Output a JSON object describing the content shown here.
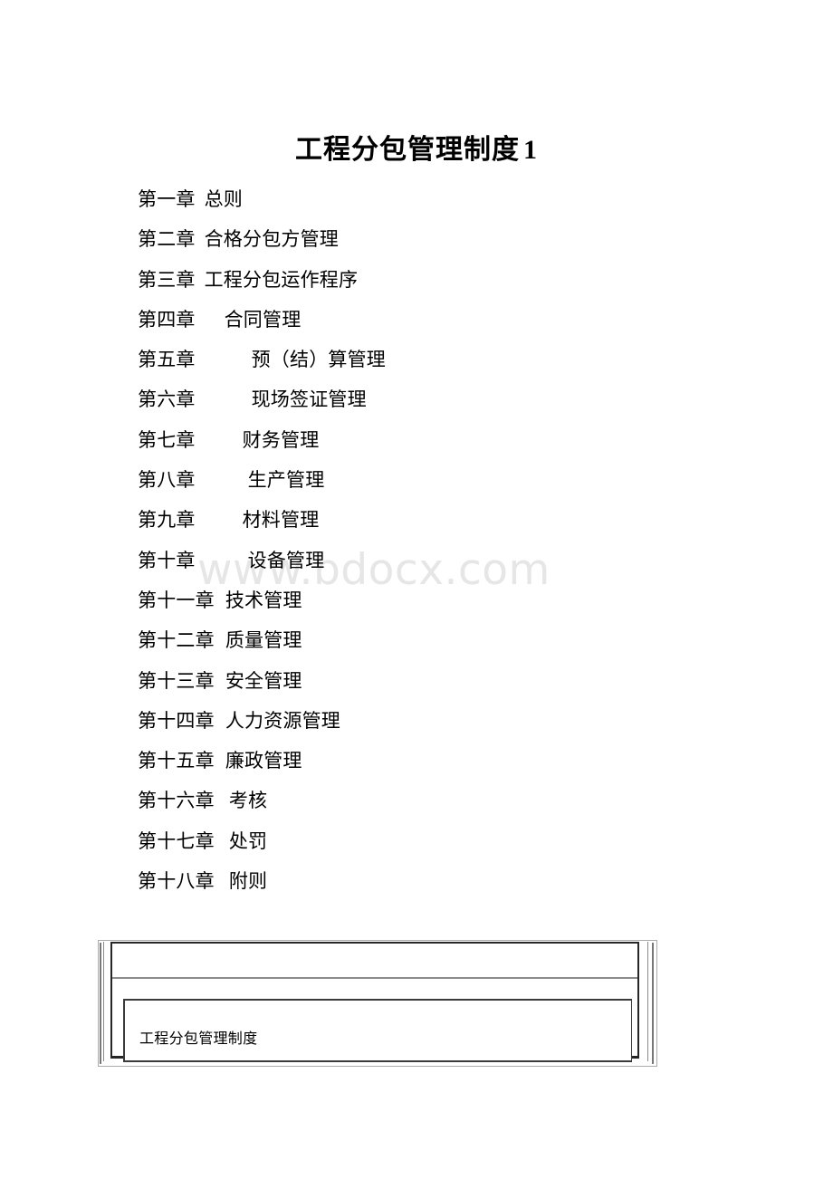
{
  "document": {
    "title_main": "工程分包管理制度",
    "title_suffix": "1"
  },
  "watermark": {
    "text": "www.bdocx.com",
    "color": "#e6e6e6"
  },
  "toc": {
    "entries": [
      {
        "chapter": "第一章",
        "title": "总则",
        "indent": 0,
        "gap": 10
      },
      {
        "chapter": "第二章",
        "title": "合格分包方管理",
        "indent": 0,
        "gap": 10
      },
      {
        "chapter": "第三章",
        "title": "工程分包运作程序",
        "indent": 0,
        "gap": 10
      },
      {
        "chapter": "第四章",
        "title": "合同管理",
        "indent": 0,
        "gap": 32
      },
      {
        "chapter": "第五章",
        "title": "预（结）算管理",
        "indent": 0,
        "gap": 62
      },
      {
        "chapter": "第六章",
        "title": "现场签证管理",
        "indent": 0,
        "gap": 62
      },
      {
        "chapter": "第七章",
        "title": "财务管理",
        "indent": 0,
        "gap": 52
      },
      {
        "chapter": "第八章",
        "title": "生产管理",
        "indent": 0,
        "gap": 58
      },
      {
        "chapter": "第九章",
        "title": "材料管理",
        "indent": 0,
        "gap": 52
      },
      {
        "chapter": "第十章",
        "title": "设备管理",
        "indent": 0,
        "gap": 58
      },
      {
        "chapter": "第十一章",
        "title": "技术管理",
        "indent": 0,
        "gap": 12
      },
      {
        "chapter": "第十二章",
        "title": "质量管理",
        "indent": 0,
        "gap": 12
      },
      {
        "chapter": "第十三章",
        "title": "安全管理",
        "indent": 0,
        "gap": 12
      },
      {
        "chapter": "第十四章",
        "title": "人力资源管理",
        "indent": 0,
        "gap": 12
      },
      {
        "chapter": "第十五章",
        "title": "廉政管理",
        "indent": 0,
        "gap": 12
      },
      {
        "chapter": "第十六章",
        "title": "考核",
        "indent": 0,
        "gap": 16
      },
      {
        "chapter": "第十七章",
        "title": "处罚",
        "indent": 0,
        "gap": 16
      },
      {
        "chapter": "第十八章",
        "title": "附则",
        "indent": 0,
        "gap": 16
      }
    ]
  },
  "footer_box": {
    "cell_text": "工程分包管理制度"
  }
}
